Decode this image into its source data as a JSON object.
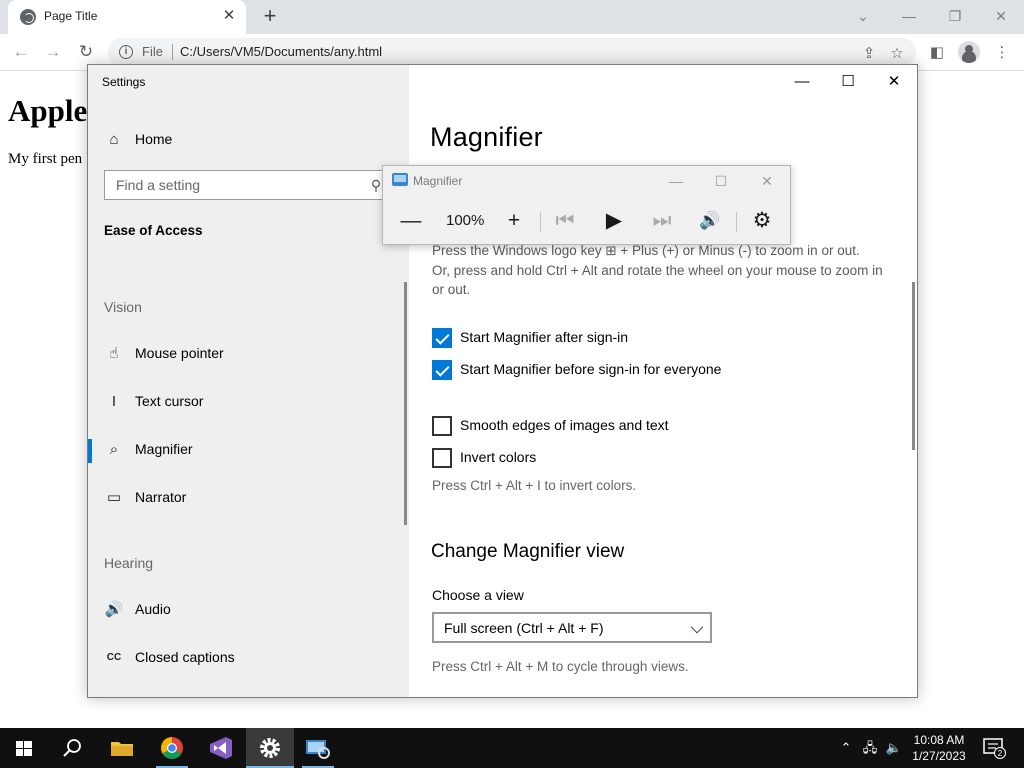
{
  "browser": {
    "tab_title": "Page Title",
    "tab_close": "✕",
    "new_tab": "+",
    "address_scheme": "File",
    "address_url": "C:/Users/VM5/Documents/any.html",
    "window_controls": {
      "chevron": "⌄",
      "minimize": "—",
      "restore": "❐",
      "close": "✕"
    }
  },
  "webpage": {
    "heading": "Apple",
    "paragraph": "My first pen"
  },
  "settings": {
    "window_title": "Settings",
    "controls": {
      "minimize": "—",
      "maximize": "☐",
      "close": "✕"
    },
    "home_label": "Home",
    "search_placeholder": "Find a setting",
    "group_title": "Ease of Access",
    "vision_label": "Vision",
    "vision_items": [
      {
        "label": "Mouse pointer",
        "icon": "☝"
      },
      {
        "label": "Text cursor",
        "icon": "I"
      },
      {
        "label": "Magnifier",
        "icon": "⌕"
      },
      {
        "label": "Narrator",
        "icon": "▭"
      }
    ],
    "hearing_label": "Hearing",
    "hearing_items": [
      {
        "label": "Audio",
        "icon": "🔊"
      },
      {
        "label": "Closed captions",
        "icon": "CC"
      }
    ],
    "page_title": "Magnifier",
    "zoom_help_line1": "Press the Windows logo key ⊞ + Plus (+) or Minus (-) to zoom in or out.",
    "zoom_help_line2": "Or, press and hold Ctrl + Alt and rotate the wheel on your mouse to zoom in or out.",
    "checkboxes": [
      {
        "label": "Start Magnifier after sign-in",
        "checked": true
      },
      {
        "label": "Start Magnifier before sign-in for everyone",
        "checked": true
      },
      {
        "label": "Smooth edges of images and text",
        "checked": false
      },
      {
        "label": "Invert colors",
        "checked": false
      }
    ],
    "invert_hint": "Press Ctrl + Alt + I to invert colors.",
    "view_heading": "Change Magnifier view",
    "view_label": "Choose a view",
    "view_value": "Full screen (Ctrl + Alt + F)",
    "view_hint": "Press Ctrl + Alt + M to cycle through views."
  },
  "magnifier_toolbar": {
    "title": "Magnifier",
    "zoom_level": "100%",
    "zoom_out": "—",
    "zoom_in": "+",
    "skip_back": "⏮",
    "play": "▶",
    "skip_forward": "⏭",
    "read_from": "🔊",
    "settings": "⚙",
    "controls": {
      "minimize": "—",
      "maximize": "☐",
      "close": "✕"
    }
  },
  "taskbar": {
    "time": "10:08 AM",
    "date": "1/27/2023",
    "notification_count": "2",
    "apps": [
      "start",
      "search",
      "file-explorer",
      "chrome",
      "visual-studio",
      "settings",
      "magnifier"
    ]
  },
  "colors": {
    "accent": "#0078d7",
    "settings_sidebar": "#efefef",
    "taskbar": "#101010"
  }
}
